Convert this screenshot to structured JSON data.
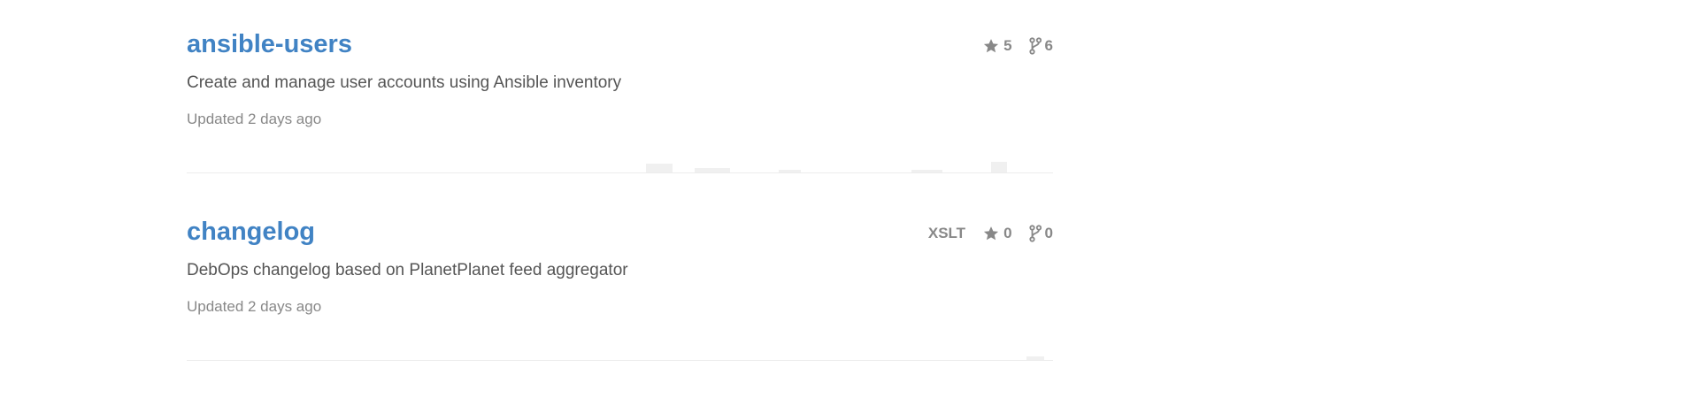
{
  "repositories": [
    {
      "name": "ansible-users",
      "description": "Create and manage user accounts using Ansible inventory",
      "updated": "Updated 2 days ago",
      "language": "",
      "stars": "5",
      "forks": "6"
    },
    {
      "name": "changelog",
      "description": "DebOps changelog based on PlanetPlanet feed aggregator",
      "updated": "Updated 2 days ago",
      "language": "XSLT",
      "stars": "0",
      "forks": "0"
    }
  ],
  "icons": {
    "stars": "star-icon",
    "forks": "fork-icon"
  },
  "colors": {
    "link": "#4183c4",
    "description": "#555555",
    "muted": "#888888",
    "divider": "#ececec"
  }
}
